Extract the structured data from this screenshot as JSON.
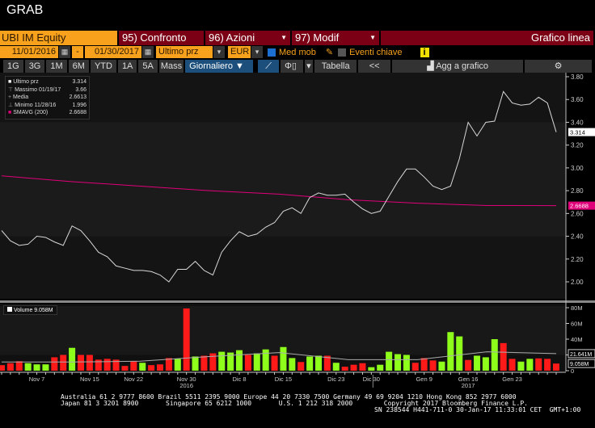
{
  "window": {
    "title": "GRAB"
  },
  "toolbar1": {
    "ticker": "UBI IM Equity",
    "compare": "95) Confronto",
    "actions": "96) Azioni",
    "modify": "97) Modif",
    "chart_type": "Grafico linea"
  },
  "toolbar2": {
    "start_date": "11/01/2016",
    "dash": "-",
    "end_date": "01/30/2017",
    "field": "Ultimo prz",
    "currency": "EUR",
    "moving_avg_label": "Med mob",
    "moving_avg_checked": true,
    "key_events_label": "Eventi chiave",
    "key_events_checked": false,
    "info": "i"
  },
  "toolbar3": {
    "periods": [
      "1G",
      "3G",
      "1M",
      "6M",
      "YTD",
      "1A",
      "5A",
      "Mass"
    ],
    "frequency": "Giornaliero ▼",
    "table": "Tabella",
    "back": "<<",
    "add_chart": "Agg a grafico"
  },
  "colors": {
    "accent": "#f7a11c",
    "header_red": "#7c0015",
    "up": "#8dff1a",
    "down": "#ff1a1a",
    "sma": "#e0007a"
  },
  "legend": [
    {
      "label": "Ultimo prz",
      "value": "3.314"
    },
    {
      "label": "Massimo 01/19/17",
      "value": "3.66"
    },
    {
      "label": "Media",
      "value": "2.6613"
    },
    {
      "label": "Minimo 11/28/16",
      "value": "1.996"
    },
    {
      "label": "SMAVG (200)",
      "value": "2.6688"
    }
  ],
  "volume_legend": "Volume 9.058M",
  "chart_data": {
    "type": "line",
    "price_axis": {
      "ticks": [
        "3.80",
        "3.60",
        "3.40",
        "3.20",
        "3.00",
        "2.80",
        "2.60",
        "2.40",
        "2.20",
        "2.00"
      ],
      "range": [
        2.0,
        3.8
      ]
    },
    "price": [
      2.45,
      2.36,
      2.32,
      2.33,
      2.4,
      2.39,
      2.35,
      2.32,
      2.49,
      2.45,
      2.36,
      2.26,
      2.22,
      2.14,
      2.12,
      2.1,
      2.1,
      2.09,
      2.06,
      2.0,
      2.11,
      2.11,
      2.18,
      2.1,
      2.06,
      2.26,
      2.36,
      2.44,
      2.4,
      2.42,
      2.48,
      2.52,
      2.62,
      2.65,
      2.6,
      2.74,
      2.78,
      2.76,
      2.76,
      2.77,
      2.7,
      2.64,
      2.6,
      2.62,
      2.75,
      2.88,
      2.99,
      2.99,
      2.92,
      2.84,
      2.81,
      2.84,
      3.08,
      3.4,
      3.28,
      3.4,
      3.41,
      3.67,
      3.57,
      3.55,
      3.56,
      3.62,
      3.57,
      3.314
    ],
    "sma200": [
      2.93,
      2.88,
      2.84,
      2.8,
      2.77,
      2.72,
      2.69,
      2.67,
      2.6688
    ],
    "last_price_label": "3.314",
    "sma_label": "2.6688",
    "volume_axis": {
      "ticks": [
        "80M",
        "60M",
        "40M",
        "20M",
        "0"
      ],
      "range": [
        0,
        80
      ]
    },
    "volume": [
      7,
      9.5,
      12,
      9.5,
      8,
      8,
      17,
      20,
      29,
      20,
      20,
      14,
      15,
      14,
      6,
      12,
      10,
      7,
      8,
      16,
      15,
      79,
      18,
      19,
      22,
      24,
      23,
      26,
      20,
      22,
      27,
      19,
      30,
      16,
      11,
      18,
      19,
      19,
      10,
      5,
      7.5,
      9.5,
      4.4,
      7.5,
      24,
      21,
      20,
      10,
      16,
      13,
      11.5,
      49,
      43.5,
      13.6,
      19,
      17,
      40,
      35,
      15,
      11.5,
      15,
      15.6,
      15,
      9
    ],
    "volume_up": [
      0,
      0,
      0,
      1,
      1,
      1,
      0,
      0,
      1,
      0,
      0,
      0,
      0,
      0,
      0,
      0,
      1,
      0,
      0,
      0,
      1,
      0,
      1,
      0,
      0,
      1,
      1,
      1,
      0,
      1,
      1,
      0,
      1,
      1,
      0,
      1,
      1,
      0,
      1,
      0,
      0,
      0,
      1,
      1,
      1,
      1,
      1,
      0,
      0,
      0,
      1,
      1,
      1,
      0,
      1,
      1,
      1,
      0,
      0,
      1,
      1,
      0,
      0,
      0
    ],
    "volume_ma": [
      11,
      11,
      12,
      18,
      23,
      14,
      14,
      24,
      21.641
    ],
    "volume_ma_label": "21.641M",
    "volume_last_label": "9.058M",
    "x_ticks": [
      {
        "label": "Nov 7",
        "i": 4
      },
      {
        "label": "Nov 15",
        "i": 10
      },
      {
        "label": "Nov 22",
        "i": 15
      },
      {
        "label": "Nov 30",
        "i": 21
      },
      {
        "label": "Dic 8",
        "i": 27
      },
      {
        "label": "Dic 15",
        "i": 32
      },
      {
        "label": "Dic 23",
        "i": 38
      },
      {
        "label": "Dic 30",
        "i": 42
      },
      {
        "label": "Gen 9",
        "i": 48
      },
      {
        "label": "Gen 16",
        "i": 53
      },
      {
        "label": "Gen 23",
        "i": 58
      }
    ],
    "years": [
      {
        "label": "2016",
        "i": 21
      },
      {
        "label": "2017",
        "i": 53
      }
    ]
  },
  "footer": {
    "line1": "Australia 61 2 9777 8600 Brazil 5511 2395 9000 Europe 44 20 7330 7500 Germany 49 69 9204 1210 Hong Kong 852 2977 6000",
    "line2": "Japan 81 3 3201 8900       Singapore 65 6212 1000       U.S. 1 212 318 2000        Copyright 2017 Bloomberg Finance L.P.",
    "line3": "SN 238544 H441-711-0 30-Jan-17 11:33:01 CET  GMT+1:00"
  }
}
